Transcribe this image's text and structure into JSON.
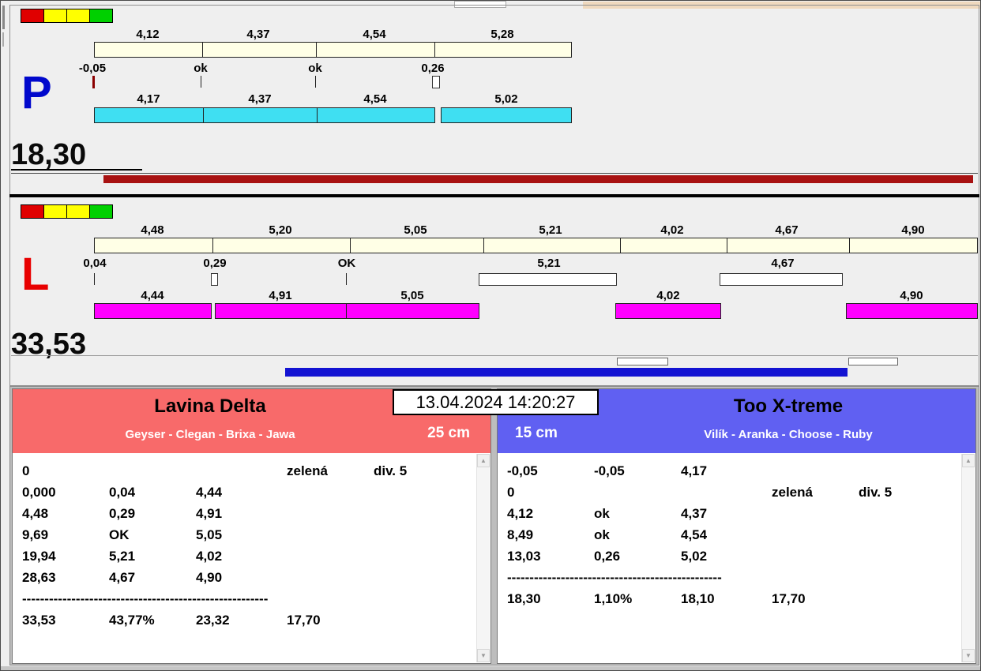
{
  "icons": {
    "scroll_up": "▲",
    "scroll_down": "▼"
  },
  "timestamp": "13.04.2024 14:20:27",
  "colors": {
    "cream_bar": "#FFFFE6",
    "cyan_bar": "#3FDFF2",
    "magenta_bar": "#FF00FF",
    "dark_red_bar": "#A81212",
    "blue_bar": "#1313D2",
    "lane_p_letter": "#0008CC",
    "lane_l_letter": "#E80000",
    "team_left_header": "#F86A6A",
    "team_right_header": "#6060F2",
    "light_red": "#E00000",
    "light_yellow": "#FFFF00",
    "light_green": "#00D000"
  },
  "lane_p": {
    "letter": "P",
    "total": "18,30",
    "splits": [
      "4,12",
      "4,37",
      "4,54",
      "5,28"
    ],
    "marks": [
      "-0,05",
      "ok",
      "ok",
      "0,26"
    ],
    "times": [
      "4,17",
      "4,37",
      "4,54",
      "5,02"
    ]
  },
  "lane_l": {
    "letter": "L",
    "total": "33,53",
    "splits": [
      "4,48",
      "5,20",
      "5,05",
      "5,21",
      "4,02",
      "4,67",
      "4,90"
    ],
    "marks": [
      "0,04",
      "0,29",
      "OK",
      "5,21",
      "4,67"
    ],
    "times": [
      "4,44",
      "4,91",
      "5,05",
      "4,02",
      "4,90"
    ]
  },
  "team_left": {
    "name": "Lavina Delta",
    "lineup": "Geyser - Clegan - Brixa - Jawa",
    "height": "25 cm",
    "rows": [
      [
        "0",
        "",
        "",
        "zelená",
        "div. 5"
      ],
      [
        "0,000",
        "0,04",
        "4,44"
      ],
      [
        "4,48",
        "0,29",
        "4,91"
      ],
      [
        "9,69",
        "OK",
        "5,05"
      ],
      [
        "19,94",
        "5,21",
        "4,02"
      ],
      [
        "28,63",
        "4,67",
        "4,90"
      ],
      [
        "-------------------------------------------------------"
      ],
      [
        "33,53",
        "43,77%",
        "23,32",
        "17,70"
      ]
    ]
  },
  "team_right": {
    "name": "Too X-treme",
    "lineup": "Vilík - Aranka - Choose - Ruby",
    "height": "15 cm",
    "rows": [
      [
        "-0,05",
        "-0,05",
        "4,17"
      ],
      [
        "0",
        "",
        "",
        "zelená",
        "div. 5"
      ],
      [
        "4,12",
        "ok",
        "4,37"
      ],
      [
        "8,49",
        "ok",
        "4,54"
      ],
      [
        "13,03",
        "0,26",
        "5,02"
      ],
      [
        "------------------------------------------------"
      ],
      [
        "18,30",
        "1,10%",
        "18,10",
        "17,70"
      ]
    ]
  }
}
